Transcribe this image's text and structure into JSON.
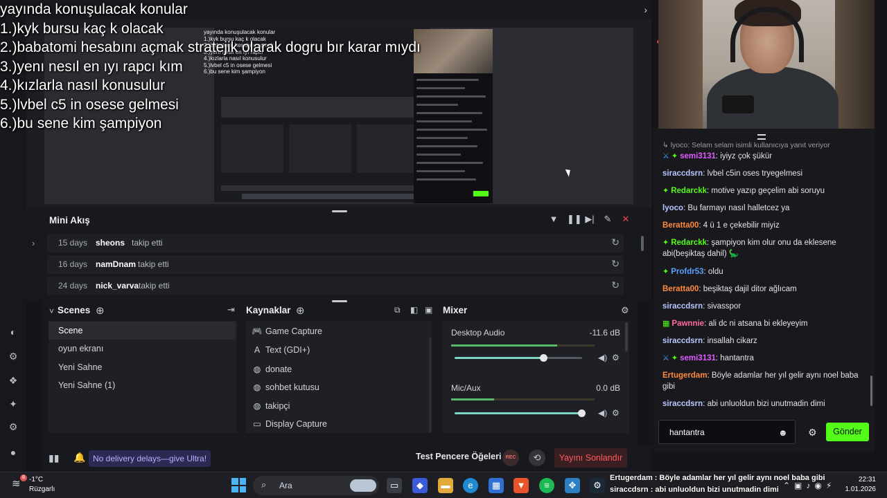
{
  "overlay_list": {
    "title": "yayında konuşulacak konular",
    "items": [
      "1.)kyk bursu kaç k olacak",
      "2.)babatomi hesabını açmak stratejik olarak dogru bır karar mıydı",
      "3.)yenı nesıl en ıyı rapcı kım",
      "4.)kızlarla nasıl konusulur",
      "5.)lvbel c5 in osese gelmesi",
      "6.)bu sene kim şampiyon"
    ]
  },
  "mini_feed": {
    "title": "Mini Akış",
    "rows": [
      {
        "days": "15 days",
        "user": "sheons",
        "action": "takip etti"
      },
      {
        "days": "16 days",
        "user": "namDnam",
        "action": "takip etti"
      },
      {
        "days": "24 days",
        "user": "nick_varva",
        "action": "takip etti"
      }
    ]
  },
  "scenes": {
    "title": "Scenes",
    "items": [
      "Scene",
      "oyun ekranı",
      "Yeni Sahne",
      "Yeni Sahne (1)"
    ],
    "active": "Scene"
  },
  "sources": {
    "title": "Kaynaklar",
    "items": [
      {
        "icon": "gamepad-icon",
        "label": "Game Capture"
      },
      {
        "icon": "text-icon",
        "label": "Text (GDI+)"
      },
      {
        "icon": "globe-icon",
        "label": "donate"
      },
      {
        "icon": "globe-icon",
        "label": "sohbet kutusu"
      },
      {
        "icon": "globe-icon",
        "label": "takipçi"
      },
      {
        "icon": "monitor-icon",
        "label": "Display Capture"
      }
    ]
  },
  "mixer": {
    "title": "Mixer",
    "channels": [
      {
        "name": "Desktop Audio",
        "db": "-11.6 dB",
        "level": 0.74,
        "volume": 0.7
      },
      {
        "name": "Mic/Aux",
        "db": "0.0 dB",
        "level": 0.3,
        "volume": 1.0
      }
    ]
  },
  "statusbar": {
    "promo": "No delivery delays—give Ultra!",
    "test_label": "Test Pencere Öğeleri",
    "rec_label": "REC",
    "end_label": "Yayını Sonlandır"
  },
  "chat": {
    "reply_hint": "lyoco: Selam selam isimli kullanıcıya yanıt veriyor",
    "messages": [
      {
        "name": "semi3131",
        "color": "#e05cff",
        "badges": [
          "sword",
          "star"
        ],
        "text": "iyiyz çok şükür"
      },
      {
        "name": "siraccdsrn",
        "color": "#b7c8ff",
        "badges": [],
        "text": "lvbel c5in oses tryegelmesi"
      },
      {
        "name": "Redarckk",
        "color": "#53fc18",
        "badges": [
          "star"
        ],
        "text": "motive yazıp geçelim abi soruyu"
      },
      {
        "name": "lyoco",
        "color": "#b7c8ff",
        "badges": [],
        "text": "Bu farmayı nasıl halletcez ya"
      },
      {
        "name": "Beratta00",
        "color": "#ff8a3d",
        "badges": [],
        "text": "4 ü 1 e çekebilir miyiz"
      },
      {
        "name": "Redarckk",
        "color": "#53fc18",
        "badges": [
          "star"
        ],
        "text": "şampiyon kim olur onu da eklesene abi(beşiktaş dahil) 🦕"
      },
      {
        "name": "Profdr53",
        "color": "#5aa0ff",
        "badges": [
          "star"
        ],
        "text": "oldu"
      },
      {
        "name": "Beratta00",
        "color": "#ff8a3d",
        "badges": [],
        "text": "beşiktaş dajil ditor ağlıcam"
      },
      {
        "name": "siraccdsrn",
        "color": "#b7c8ff",
        "badges": [],
        "text": "sivasspor"
      },
      {
        "name": "Pawnnie",
        "color": "#ff6b9d",
        "badges": [
          "gift"
        ],
        "text": "ali dc ni atsana bi ekleyeyim"
      },
      {
        "name": "siraccdsrn",
        "color": "#b7c8ff",
        "badges": [],
        "text": "insallah cikarz"
      },
      {
        "name": "semi3131",
        "color": "#e05cff",
        "badges": [
          "sword",
          "star"
        ],
        "text": "hantantra"
      },
      {
        "name": "Ertugerdam",
        "color": "#ff8a3d",
        "badges": [],
        "text": "Böyle adamlar her yıl gelir aynı noel baba gibi"
      },
      {
        "name": "siraccdsrn",
        "color": "#b7c8ff",
        "badges": [],
        "text": "abi unluoldun bizi unutmadin dimi"
      }
    ],
    "input_value": "hantantra",
    "send_label": "Gönder"
  },
  "taskbar": {
    "temperature": "-1°C",
    "condition": "Rüzgarlı",
    "weather_badge": "8",
    "search_placeholder": "Ara",
    "time": "22:31",
    "date": "1.01.2026",
    "overlay_lines": [
      "Ertugerdam : Böyle adamlar her yıl gelir aynı noel baba gibi",
      "siraccdsrn : abi unluoldun bizi unutmadin dimi"
    ]
  },
  "preview_overlay": {
    "title": "yayında konuşulacak konular",
    "lines": [
      "1.)kyk bursu kaç k olacak",
      "2.)babatomi hesabını açmak",
      "3.)yenı nesıl en ıyı rapcı",
      "4.)kızlarla nasıl konusulur",
      "5.)lvbel c5 in osese gelmesi",
      "6.)bu sene kim şampiyon"
    ]
  },
  "colors": {
    "accent_green": "#53fc18",
    "end_red": "#ff5a5f",
    "slider_teal": "#7ad7c1"
  }
}
